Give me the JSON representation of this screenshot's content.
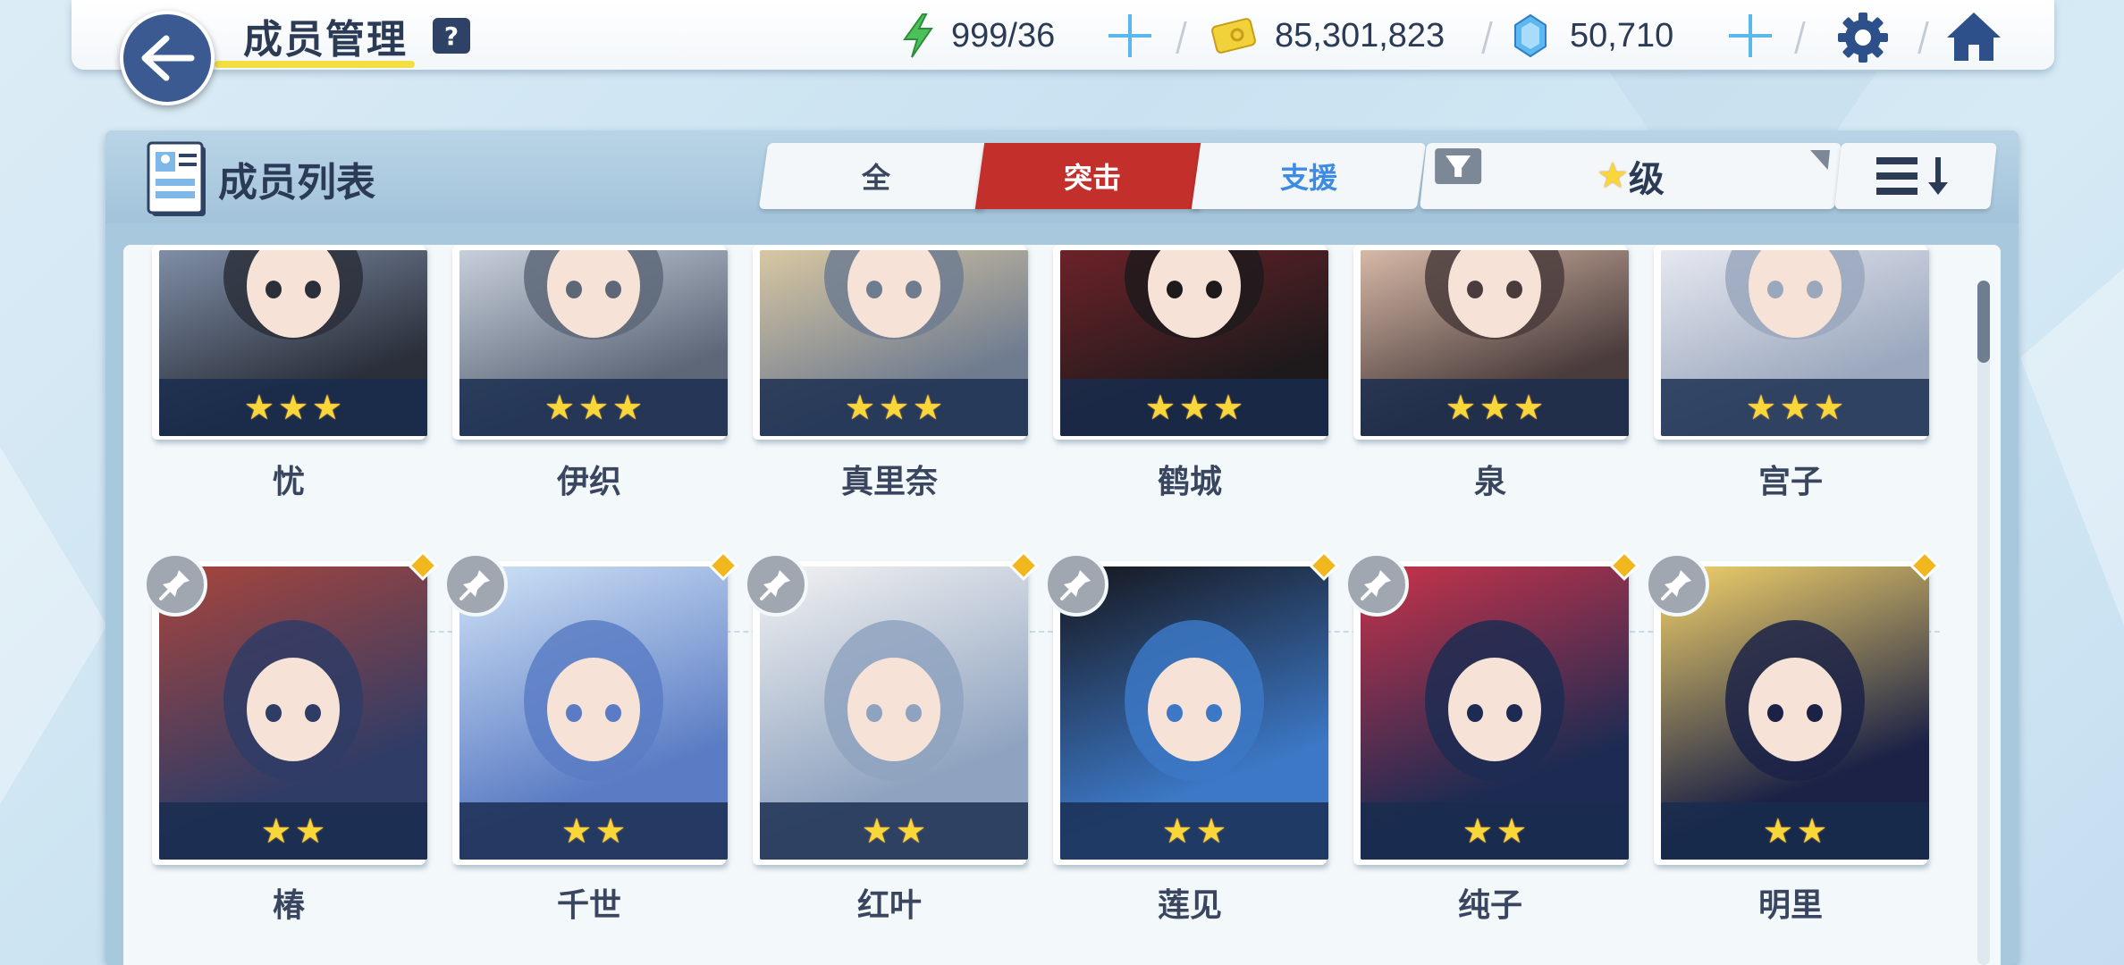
{
  "header": {
    "title": "成员管理",
    "help": "?",
    "ap": "999/36",
    "credits": "85,301,823",
    "gems": "50,710"
  },
  "panel": {
    "title": "成员列表",
    "tabs": [
      {
        "label": "全",
        "active": false
      },
      {
        "label": "突击",
        "active": true
      },
      {
        "label": "支援",
        "active": false
      }
    ],
    "sort_label": "级",
    "sort_star": "★"
  },
  "members_row1": [
    {
      "name": "忧",
      "stars": 3
    },
    {
      "name": "伊织",
      "stars": 3
    },
    {
      "name": "真里奈",
      "stars": 3
    },
    {
      "name": "鹤城",
      "stars": 3
    },
    {
      "name": "泉",
      "stars": 3
    },
    {
      "name": "宫子",
      "stars": 3
    }
  ],
  "members_row2": [
    {
      "name": "椿",
      "stars": 2
    },
    {
      "name": "千世",
      "stars": 2
    },
    {
      "name": "红叶",
      "stars": 2
    },
    {
      "name": "莲见",
      "stars": 2
    },
    {
      "name": "纯子",
      "stars": 2
    },
    {
      "name": "明里",
      "stars": 2
    }
  ],
  "colors": {
    "accent_red": "#c3302b",
    "navy": "#2b3a55",
    "star": "#f9d63a",
    "support_blue": "#3d8ce3"
  }
}
